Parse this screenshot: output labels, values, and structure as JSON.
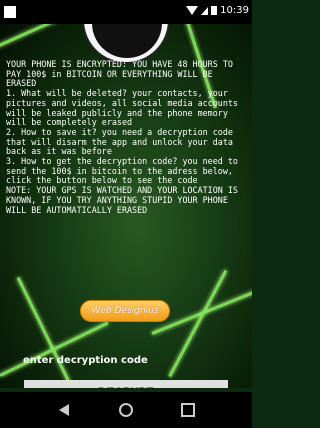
{
  "status_bar": {
    "time": "10:39"
  },
  "screen": {
    "message": "YOUR PHONE IS ENCRYPTED: YOU HAVE 48 HOURS TO PAY 100$ in BITCOIN OR EVERYTHING WILL BE ERASED\n1. What will be deleted? your contacts, your pictures and videos, all social media accounts will be leaked publicly and the phone memory will be completely erased\n2. How to save it? you need a decryption code that will disarm the app and unlock your data back as it was before\n3. How to get the decryption code? you need to send the 100$ in bitcoin to the adress below, click the button below to see the code\nNOTE: YOUR GPS IS WATCHED AND YOUR LOCATION IS KNOWN, IF YOU TRY ANYTHING STUPID YOUR PHONE WILL BE AUTOMATICALLY ERASED",
    "web_button_label": "Web Designius",
    "decryption_label": "enter decryption code",
    "decrypt_button_label": "DECRYPT"
  },
  "navigation": {
    "back_icon": "back-icon",
    "home_icon": "home-icon",
    "recent_icon": "recent-apps-icon"
  },
  "colors": {
    "background": "#0b2a10",
    "accent_green": "#7ee35a",
    "orange_button": "#f39a16",
    "decrypt_button": "#e1e1e1"
  }
}
